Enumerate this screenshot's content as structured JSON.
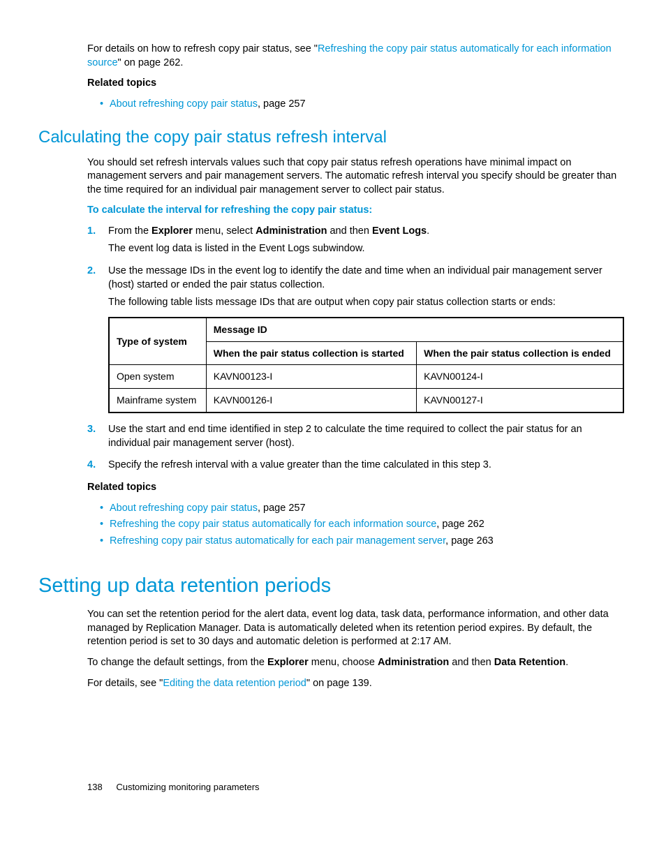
{
  "intro": {
    "pre": "For details on how to refresh copy pair status, see \"",
    "link": "Refreshing the copy pair status automatically for each information source",
    "post": "\" on page 262."
  },
  "relatedTopics1": {
    "heading": "Related topics",
    "items": [
      {
        "link": "About refreshing copy pair status",
        "tail": ", page 257"
      }
    ]
  },
  "section1": {
    "title": "Calculating the copy pair status refresh interval",
    "para": "You should set refresh intervals values such that copy pair status refresh operations have minimal impact on management servers and pair management servers. The automatic refresh interval you specify should be greater than the time required for an individual pair management server to collect pair status.",
    "procTitle": "To calculate the interval for refreshing the copy pair status:",
    "step1": {
      "pre": "From the ",
      "b1": "Explorer",
      "mid1": " menu, select ",
      "b2": "Administration",
      "mid2": " and then ",
      "b3": "Event Logs",
      "post": ".",
      "sub": "The event log data is listed in the Event Logs subwindow."
    },
    "step2": {
      "text": "Use the message IDs in the event log to identify the date and time when an individual pair management server (host) started or ended the pair status collection.",
      "sub": "The following table lists message IDs that are output when copy pair status collection starts or ends:"
    },
    "table": {
      "h_type": "Type of system",
      "h_msgid": "Message ID",
      "h_start": "When the pair status collection is started",
      "h_end": "When the pair status collection is ended",
      "rows": [
        {
          "type": "Open system",
          "start": "KAVN00123-I",
          "end": "KAVN00124-I"
        },
        {
          "type": "Mainframe system",
          "start": "KAVN00126-I",
          "end": "KAVN00127-I"
        }
      ]
    },
    "step3": "Use the start and end time identified in step 2 to calculate the time required to collect the pair status for an individual pair management server (host).",
    "step4": "Specify the refresh interval with a value greater than the time calculated in this step 3."
  },
  "relatedTopics2": {
    "heading": "Related topics",
    "items": [
      {
        "link": "About refreshing copy pair status",
        "tail": ", page 257"
      },
      {
        "link": "Refreshing the copy pair status automatically for each information source",
        "tail": ", page 262"
      },
      {
        "link": "Refreshing copy pair status automatically for each pair management server",
        "tail": ", page 263"
      }
    ]
  },
  "section2": {
    "title": "Setting up data retention periods",
    "para1": "You can set the retention period for the alert data, event log data, task data, performance information, and other data managed by Replication Manager. Data is automatically deleted when its retention period expires. By default, the retention period is set to 30 days and automatic deletion is performed at 2:17 AM.",
    "para2": {
      "pre": "To change the default settings, from the ",
      "b1": "Explorer",
      "mid1": " menu, choose ",
      "b2": "Administration",
      "mid2": " and then ",
      "b3": "Data Retention",
      "post": "."
    },
    "para3": {
      "pre": "For details, see \"",
      "link": "Editing the data retention period",
      "post": "\" on page 139."
    }
  },
  "footer": {
    "page": "138",
    "chapter": "Customizing monitoring parameters"
  }
}
